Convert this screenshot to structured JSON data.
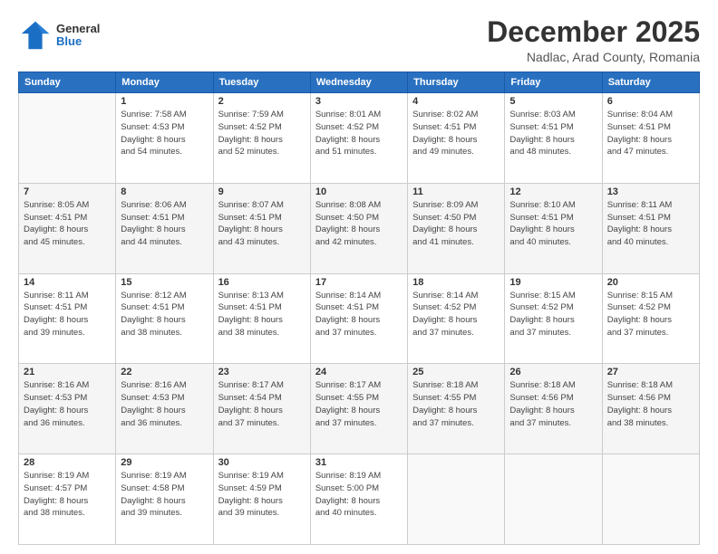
{
  "logo": {
    "general": "General",
    "blue": "Blue"
  },
  "title": "December 2025",
  "subtitle": "Nadlac, Arad County, Romania",
  "days_of_week": [
    "Sunday",
    "Monday",
    "Tuesday",
    "Wednesday",
    "Thursday",
    "Friday",
    "Saturday"
  ],
  "weeks": [
    [
      {
        "day": "",
        "info": ""
      },
      {
        "day": "1",
        "info": "Sunrise: 7:58 AM\nSunset: 4:53 PM\nDaylight: 8 hours\nand 54 minutes."
      },
      {
        "day": "2",
        "info": "Sunrise: 7:59 AM\nSunset: 4:52 PM\nDaylight: 8 hours\nand 52 minutes."
      },
      {
        "day": "3",
        "info": "Sunrise: 8:01 AM\nSunset: 4:52 PM\nDaylight: 8 hours\nand 51 minutes."
      },
      {
        "day": "4",
        "info": "Sunrise: 8:02 AM\nSunset: 4:51 PM\nDaylight: 8 hours\nand 49 minutes."
      },
      {
        "day": "5",
        "info": "Sunrise: 8:03 AM\nSunset: 4:51 PM\nDaylight: 8 hours\nand 48 minutes."
      },
      {
        "day": "6",
        "info": "Sunrise: 8:04 AM\nSunset: 4:51 PM\nDaylight: 8 hours\nand 47 minutes."
      }
    ],
    [
      {
        "day": "7",
        "info": "Sunrise: 8:05 AM\nSunset: 4:51 PM\nDaylight: 8 hours\nand 45 minutes."
      },
      {
        "day": "8",
        "info": "Sunrise: 8:06 AM\nSunset: 4:51 PM\nDaylight: 8 hours\nand 44 minutes."
      },
      {
        "day": "9",
        "info": "Sunrise: 8:07 AM\nSunset: 4:51 PM\nDaylight: 8 hours\nand 43 minutes."
      },
      {
        "day": "10",
        "info": "Sunrise: 8:08 AM\nSunset: 4:50 PM\nDaylight: 8 hours\nand 42 minutes."
      },
      {
        "day": "11",
        "info": "Sunrise: 8:09 AM\nSunset: 4:50 PM\nDaylight: 8 hours\nand 41 minutes."
      },
      {
        "day": "12",
        "info": "Sunrise: 8:10 AM\nSunset: 4:51 PM\nDaylight: 8 hours\nand 40 minutes."
      },
      {
        "day": "13",
        "info": "Sunrise: 8:11 AM\nSunset: 4:51 PM\nDaylight: 8 hours\nand 40 minutes."
      }
    ],
    [
      {
        "day": "14",
        "info": "Sunrise: 8:11 AM\nSunset: 4:51 PM\nDaylight: 8 hours\nand 39 minutes."
      },
      {
        "day": "15",
        "info": "Sunrise: 8:12 AM\nSunset: 4:51 PM\nDaylight: 8 hours\nand 38 minutes."
      },
      {
        "day": "16",
        "info": "Sunrise: 8:13 AM\nSunset: 4:51 PM\nDaylight: 8 hours\nand 38 minutes."
      },
      {
        "day": "17",
        "info": "Sunrise: 8:14 AM\nSunset: 4:51 PM\nDaylight: 8 hours\nand 37 minutes."
      },
      {
        "day": "18",
        "info": "Sunrise: 8:14 AM\nSunset: 4:52 PM\nDaylight: 8 hours\nand 37 minutes."
      },
      {
        "day": "19",
        "info": "Sunrise: 8:15 AM\nSunset: 4:52 PM\nDaylight: 8 hours\nand 37 minutes."
      },
      {
        "day": "20",
        "info": "Sunrise: 8:15 AM\nSunset: 4:52 PM\nDaylight: 8 hours\nand 37 minutes."
      }
    ],
    [
      {
        "day": "21",
        "info": "Sunrise: 8:16 AM\nSunset: 4:53 PM\nDaylight: 8 hours\nand 36 minutes."
      },
      {
        "day": "22",
        "info": "Sunrise: 8:16 AM\nSunset: 4:53 PM\nDaylight: 8 hours\nand 36 minutes."
      },
      {
        "day": "23",
        "info": "Sunrise: 8:17 AM\nSunset: 4:54 PM\nDaylight: 8 hours\nand 37 minutes."
      },
      {
        "day": "24",
        "info": "Sunrise: 8:17 AM\nSunset: 4:55 PM\nDaylight: 8 hours\nand 37 minutes."
      },
      {
        "day": "25",
        "info": "Sunrise: 8:18 AM\nSunset: 4:55 PM\nDaylight: 8 hours\nand 37 minutes."
      },
      {
        "day": "26",
        "info": "Sunrise: 8:18 AM\nSunset: 4:56 PM\nDaylight: 8 hours\nand 37 minutes."
      },
      {
        "day": "27",
        "info": "Sunrise: 8:18 AM\nSunset: 4:56 PM\nDaylight: 8 hours\nand 38 minutes."
      }
    ],
    [
      {
        "day": "28",
        "info": "Sunrise: 8:19 AM\nSunset: 4:57 PM\nDaylight: 8 hours\nand 38 minutes."
      },
      {
        "day": "29",
        "info": "Sunrise: 8:19 AM\nSunset: 4:58 PM\nDaylight: 8 hours\nand 39 minutes."
      },
      {
        "day": "30",
        "info": "Sunrise: 8:19 AM\nSunset: 4:59 PM\nDaylight: 8 hours\nand 39 minutes."
      },
      {
        "day": "31",
        "info": "Sunrise: 8:19 AM\nSunset: 5:00 PM\nDaylight: 8 hours\nand 40 minutes."
      },
      {
        "day": "",
        "info": ""
      },
      {
        "day": "",
        "info": ""
      },
      {
        "day": "",
        "info": ""
      }
    ]
  ]
}
